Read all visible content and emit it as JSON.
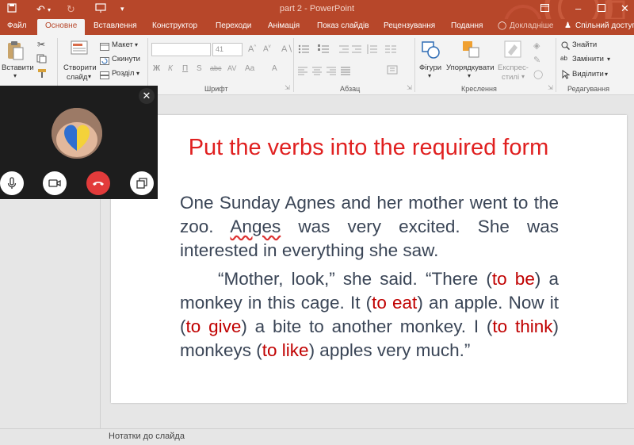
{
  "window": {
    "title": "part 2 - PowerPoint"
  },
  "tabs": [
    {
      "label": "Файл"
    },
    {
      "label": "Основне"
    },
    {
      "label": "Вставлення"
    },
    {
      "label": "Конструктор"
    },
    {
      "label": "Переходи"
    },
    {
      "label": "Анімація"
    },
    {
      "label": "Показ слайдів"
    },
    {
      "label": "Рецензування"
    },
    {
      "label": "Подання"
    }
  ],
  "tell_me": "Докладніше",
  "share": "Спільний доступ",
  "ribbon": {
    "paste": "Вставити",
    "new_slide_1": "Створити",
    "new_slide_2": "слайд",
    "layout": "Макет",
    "reset": "Скинути",
    "section": "Розділ",
    "font_size": "41",
    "shapes": "Фігури",
    "arrange": "Упорядкувати",
    "express_1": "Експрес-",
    "express_2": "стилі",
    "find": "Знайти",
    "replace": "Замінити",
    "select": "Виділити",
    "groups": {
      "font": "Шрифт",
      "paragraph": "Абзац",
      "drawing": "Креслення",
      "editing": "Редагування"
    }
  },
  "slide": {
    "title": "Put the verbs into the required form",
    "para1_a": "One Sunday Agnes and her mother went to the zoo. ",
    "para1_misspelled": "Anges",
    "para1_b": " was very excited. She was interested in everything she saw.",
    "para2": {
      "t1": "“Mother, look,” she said. “There (",
      "v1": "to be",
      "t2": ") a monkey in this cage. It (",
      "v2": "to eat",
      "t3": ") an apple. Now it (",
      "v3": "to give",
      "t4": ") a bite to another monkey. I (",
      "v4": "to think",
      "t5": ") monkeys (",
      "v5": "to like",
      "t6": ") apples very much.”"
    }
  },
  "notes": "Нотатки до слайда",
  "call": {
    "icons": [
      "close-icon",
      "microphone-icon",
      "camera-icon",
      "hang-up-icon",
      "popout-icon"
    ]
  }
}
